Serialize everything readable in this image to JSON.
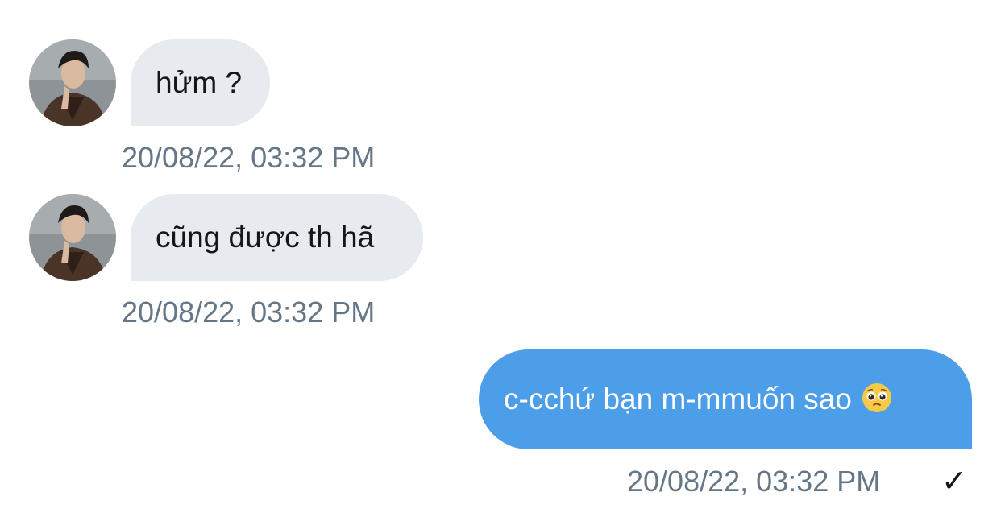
{
  "messages": [
    {
      "direction": "incoming",
      "text": "hửm ?",
      "timestamp": "20/08/22, 03:32 PM",
      "avatar_icon": "user-avatar"
    },
    {
      "direction": "incoming",
      "text": "cũng được th hã",
      "timestamp": "20/08/22, 03:32 PM",
      "avatar_icon": "user-avatar"
    },
    {
      "direction": "outgoing",
      "text": "c-cchứ bạn m-mmuốn sao",
      "emoji": "pleading-face-emoji",
      "timestamp": "20/08/22, 03:32 PM",
      "status": "✓"
    }
  ],
  "colors": {
    "incoming_bubble": "#e7eaee",
    "outgoing_bubble": "#4d9ee9",
    "timestamp": "#657786"
  }
}
